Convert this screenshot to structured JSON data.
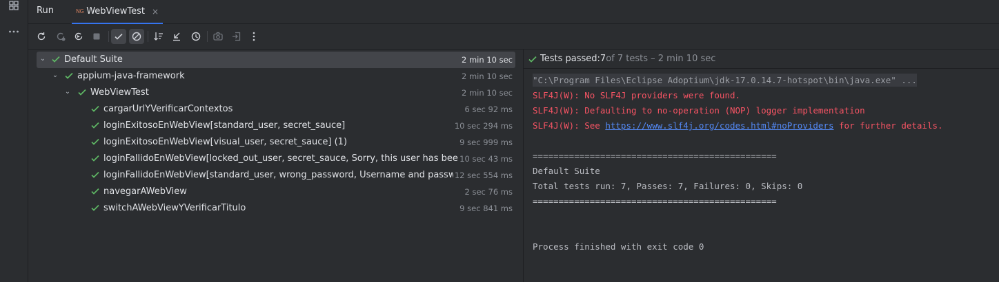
{
  "run_panel": {
    "title": "Run"
  },
  "tab": {
    "icon_text": "NG",
    "label": "WebViewTest",
    "close": "×"
  },
  "tree": {
    "rows": [
      {
        "name": "Default Suite",
        "time": "2 min 10 sec"
      },
      {
        "name": "appium-java-framework",
        "time": "2 min 10 sec"
      },
      {
        "name": "WebViewTest",
        "time": "2 min 10 sec"
      },
      {
        "name": "cargarUrlYVerificarContextos",
        "time": "6 sec 92 ms"
      },
      {
        "name": "loginExitosoEnWebView[standard_user, secret_sauce]",
        "time": "10 sec 294 ms"
      },
      {
        "name": "loginExitosoEnWebView[visual_user, secret_sauce] (1)",
        "time": "9 sec 999 ms"
      },
      {
        "name": "loginFallidoEnWebView[locked_out_user, secret_sauce, Sorry, this user has been locked out.]",
        "time": "10 sec 43 ms"
      },
      {
        "name": "loginFallidoEnWebView[standard_user, wrong_password, Username and password do not match]",
        "time": "12 sec 554 ms"
      },
      {
        "name": "navegarAWebView",
        "time": "2 sec 76 ms"
      },
      {
        "name": "switchAWebViewYVerificarTitulo",
        "time": "9 sec 841 ms"
      }
    ]
  },
  "status": {
    "prefix": "Tests passed: ",
    "passed": "7",
    "rest": " of 7 tests – 2 min 10 sec"
  },
  "console": {
    "cmd": "\"C:\\Program Files\\Eclipse Adoptium\\jdk-17.0.14.7-hotspot\\bin\\java.exe\" ...",
    "err1": "SLF4J(W): No SLF4J providers were found.",
    "err2": "SLF4J(W): Defaulting to no-operation (NOP) logger implementation",
    "err3_prefix": "SLF4J(W): See ",
    "err3_link": "https://www.slf4j.org/codes.html#noProviders",
    "err3_suffix": " for further details.",
    "sep1": "===============================================",
    "suite": "Default Suite",
    "summary": "Total tests run: 7, Passes: 7, Failures: 0, Skips: 0",
    "sep2": "===============================================",
    "finished": "Process finished with exit code 0"
  },
  "colors": {
    "pass": "#5fb865",
    "error": "#f75464",
    "link": "#548af7",
    "accent": "#3574f0"
  }
}
